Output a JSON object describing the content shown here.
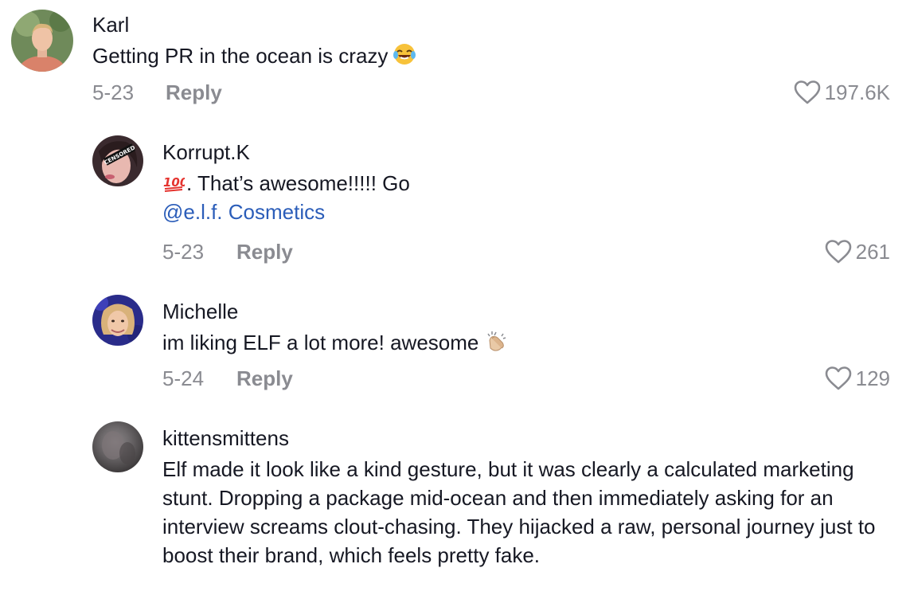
{
  "comments": [
    {
      "username": "Karl",
      "text": "Getting PR in the ocean is crazy",
      "emoji": "laughing-tears-emoji",
      "date": "5-23",
      "reply_label": "Reply",
      "likes": "197.6K"
    },
    {
      "username": "Korrupt.K",
      "avatar_badge": "CENSORED",
      "text_prefix_emoji": "hundred-points-emoji",
      "text": ". That’s awesome!!!!! Go",
      "mention": "@e.l.f. Cosmetics",
      "date": "5-23",
      "reply_label": "Reply",
      "likes": "261"
    },
    {
      "username": "Michelle",
      "text": "im liking ELF a lot more! awesome",
      "emoji": "clapping-hands-emoji",
      "date": "5-24",
      "reply_label": "Reply",
      "likes": "129"
    },
    {
      "username": "kittensmittens",
      "text": "Elf made it look like a kind gesture, but it was clearly a calculated marketing stunt. Dropping a package mid-ocean and then immediately asking for an interview screams clout-chasing. They hijacked a raw, personal journey just to boost their brand, which feels pretty fake."
    }
  ],
  "colors": {
    "text": "#161823",
    "secondary": "#8a8b91",
    "mention": "#2b5db9"
  }
}
